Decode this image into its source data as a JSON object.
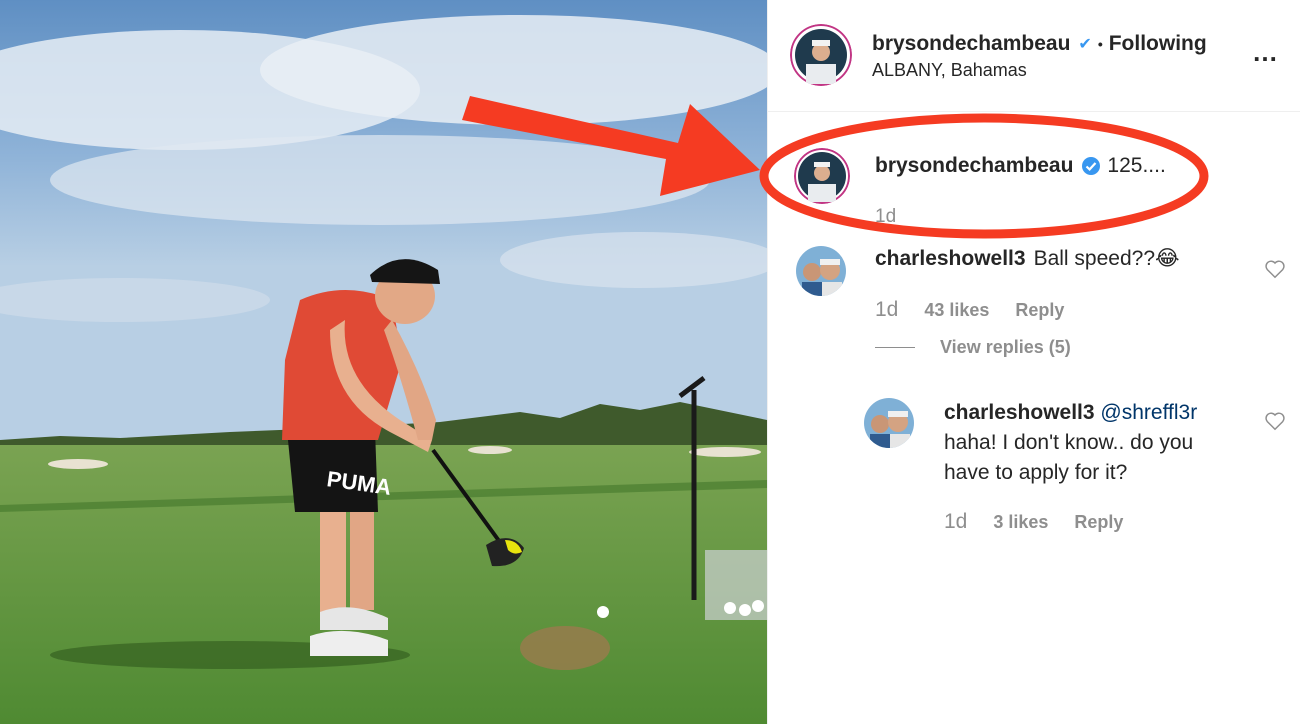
{
  "post": {
    "author": "brysondechambeau",
    "follow_status": "Following",
    "location": "ALBANY, Bahamas",
    "caption_user": "brysondechambeau",
    "caption_text": "125....",
    "caption_time": "1d",
    "more_icon": "more-icon",
    "verified_icon": "verified-badge-icon"
  },
  "comments": [
    {
      "user": "charleshowell3",
      "text": "Ball speed??😂",
      "time": "1d",
      "likes": "43 likes",
      "reply_label": "Reply",
      "view_replies": "View replies (5)"
    }
  ],
  "replies": [
    {
      "user": "charleshowell3",
      "mention": "@shreffl3r",
      "text": "haha! I don't know.. do you have to apply for it?",
      "time": "1d",
      "likes": "3 likes",
      "reply_label": "Reply"
    }
  ],
  "colors": {
    "annotation_red": "#f53b22",
    "verified_blue": "#3897f0",
    "secondary_text": "#8e8e8e",
    "mention": "#003569"
  }
}
